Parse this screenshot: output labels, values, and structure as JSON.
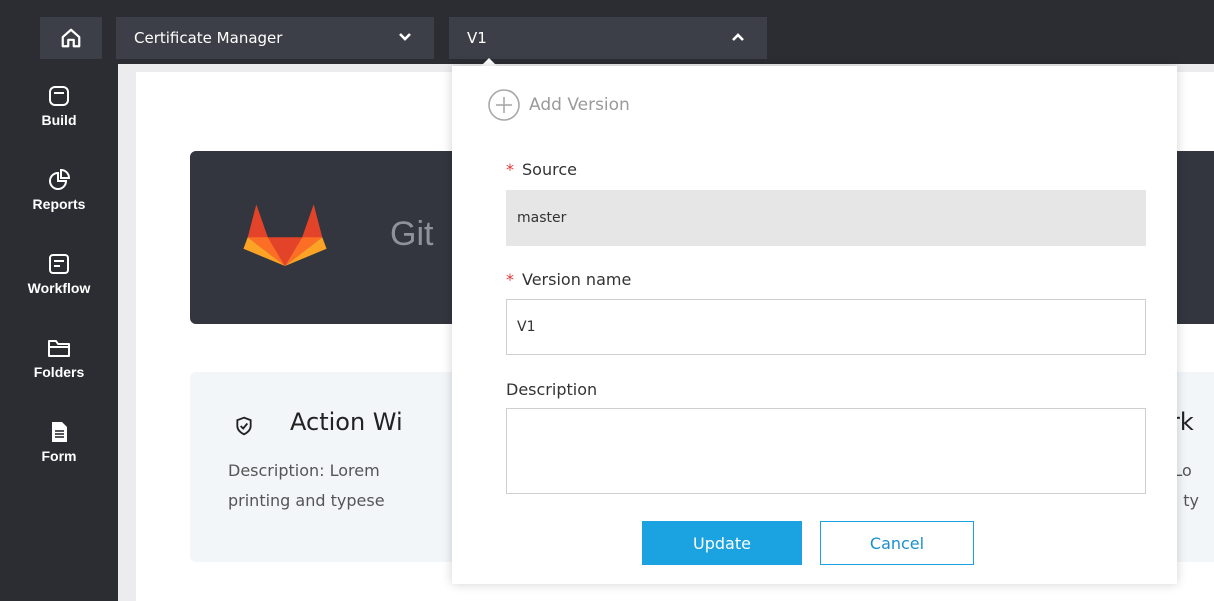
{
  "topbar": {
    "app_selector": {
      "value": "Certificate Manager"
    },
    "version_selector": {
      "value": "V1"
    }
  },
  "sidebar": {
    "items": [
      {
        "label": "Build",
        "icon": "build-icon"
      },
      {
        "label": "Reports",
        "icon": "reports-icon"
      },
      {
        "label": "Workflow",
        "icon": "workflow-icon"
      },
      {
        "label": "Folders",
        "icon": "folders-icon"
      },
      {
        "label": "Form",
        "icon": "form-icon"
      }
    ]
  },
  "background": {
    "hero_title": "Git",
    "card_title": "Action Wi",
    "card_desc_line1": "Description: Lorem",
    "card_desc_line2": "printing and typese",
    "card2_title": "rk",
    "card2_desc_line1": ":Lo",
    "card2_desc_line2": "d ty"
  },
  "popover": {
    "add_version_label": "Add Version",
    "source_label": "Source",
    "source_value": "master",
    "version_name_label": "Version name",
    "version_name_value": "V1",
    "description_label": "Description",
    "description_value": "",
    "update_label": "Update",
    "cancel_label": "Cancel"
  },
  "colors": {
    "accent": "#1aa3e0",
    "required": "#e53935",
    "topbar": "#2b2d33"
  }
}
